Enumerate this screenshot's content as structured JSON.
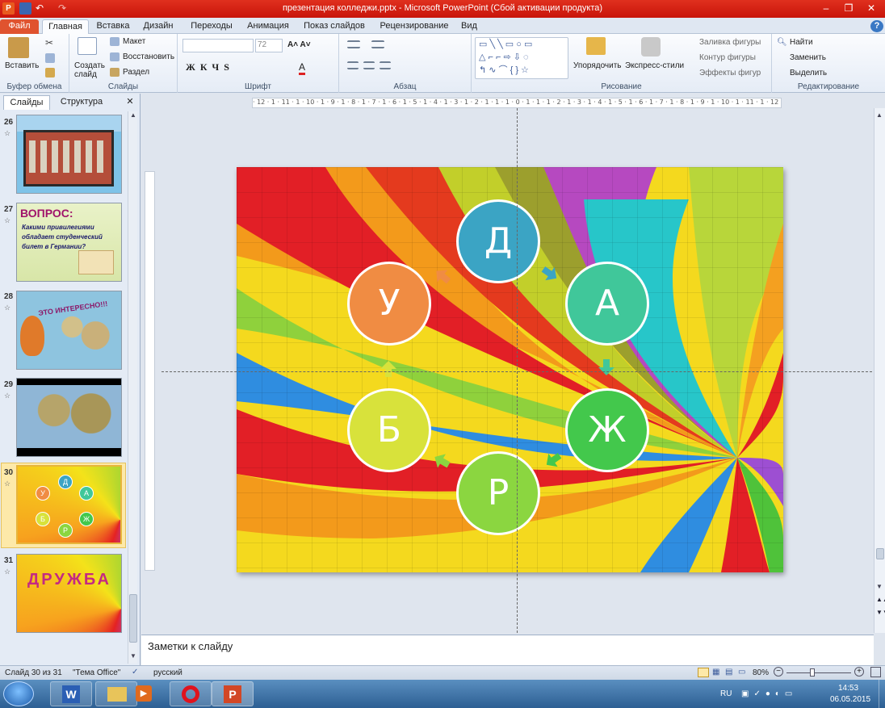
{
  "window": {
    "title": "презентация колледжи.pptx - Microsoft PowerPoint (Сбой активации продукта)",
    "controls": [
      "–",
      "❐",
      "✕"
    ]
  },
  "tabs": [
    "Файл",
    "Главная",
    "Вставка",
    "Дизайн",
    "Переходы",
    "Анимация",
    "Показ слайдов",
    "Рецензирование",
    "Вид"
  ],
  "ribbon": {
    "clipboard": {
      "paste": "Вставить",
      "label": "Буфер обмена"
    },
    "slides": {
      "create": "Создать слайд",
      "layout": "Макет",
      "reset": "Восстановить",
      "section": "Раздел",
      "label": "Слайды"
    },
    "font": {
      "size": "72",
      "label": "Шрифт"
    },
    "paragraph": {
      "label": "Абзац"
    },
    "drawing": {
      "arrange": "Упорядочить",
      "styles": "Экспресс-стили",
      "fill": "Заливка фигуры",
      "outline": "Контур фигуры",
      "effects": "Эффекты фигур",
      "label": "Рисование"
    },
    "editing": {
      "find": "Найти",
      "replace": "Заменить",
      "select": "Выделить",
      "label": "Редактирование"
    }
  },
  "panel": {
    "tabs": [
      "Слайды",
      "Структура"
    ],
    "close": "✕",
    "slides": [
      {
        "num": "26"
      },
      {
        "num": "27",
        "title": "ВОПРОС:",
        "text": "Какими привилегиями обладает студенческий билет в Германии?"
      },
      {
        "num": "28",
        "text": "ЭТО ИНТЕРЕСНО!!!"
      },
      {
        "num": "29"
      },
      {
        "num": "30",
        "letters": [
          "У",
          "Д",
          "А",
          "Б",
          "Р",
          "Ж"
        ]
      },
      {
        "num": "31",
        "text": "ДРУЖБА"
      }
    ]
  },
  "ruler_top": "· 12 · 1 · 11 · 1 · 10 · 1 · 9 · 1 · 8 · 1 · 7 · 1 · 6 · 1 · 5 · 1 · 4 · 1 · 3 · 1 · 2 · 1 · 1 · 1 · 0 · 1 · 1 · 1 · 2 · 1 · 3 · 1 · 4 · 1 · 5 · 1 · 6 · 1 · 7 · 1 · 8 · 1 · 9 · 1 · 10 · 1 · 11 · 1 · 12 ·",
  "slide": {
    "circles": [
      {
        "letter": "Д",
        "color": "#3ba4c4"
      },
      {
        "letter": "А",
        "color": "#40c79a"
      },
      {
        "letter": "Ж",
        "color": "#43c84c"
      },
      {
        "letter": "Р",
        "color": "#8bd640"
      },
      {
        "letter": "Б",
        "color": "#d8e23b"
      },
      {
        "letter": "У",
        "color": "#f08c43"
      }
    ]
  },
  "notes": {
    "placeholder": "Заметки к слайду"
  },
  "status": {
    "slide": "Слайд 30 из 31",
    "theme": "\"Тема Office\"",
    "lang": "русский",
    "zoom": "80%"
  },
  "taskbar": {
    "lang": "RU",
    "time": "14:53",
    "date": "06.05.2015"
  },
  "colors": {
    "titlebar": "#d8200f",
    "file_tab": "#e0532f",
    "selection": "#fde9a9"
  }
}
